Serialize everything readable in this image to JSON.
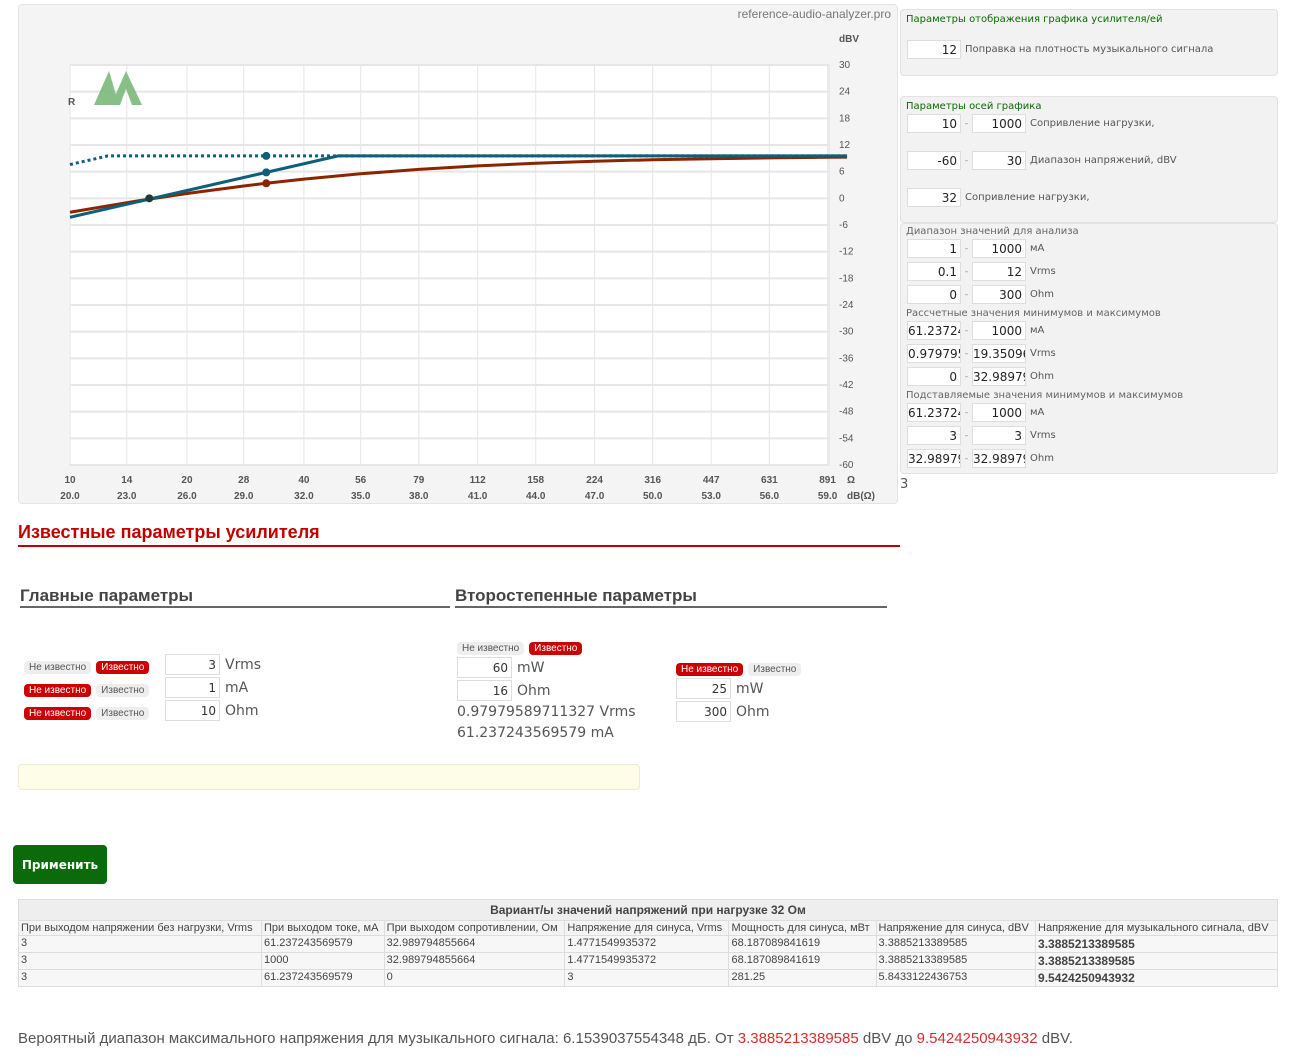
{
  "site": "reference-audio-analyzer.pro",
  "chart_data": {
    "type": "line",
    "x_scale": "log",
    "xlim": [
      10,
      1000
    ],
    "ylim": [
      -60,
      30
    ],
    "ylabel": "dBV",
    "xlabel_top": "Ω",
    "xlabel_bottom": "dB(Ω)",
    "x_ticks": [
      "10",
      "14",
      "20",
      "28",
      "40",
      "56",
      "79",
      "112",
      "158",
      "224",
      "316",
      "447",
      "631",
      "891"
    ],
    "x_ticks_db": [
      "20.0",
      "23.0",
      "26.0",
      "29.0",
      "32.0",
      "35.0",
      "38.0",
      "41.0",
      "44.0",
      "47.0",
      "50.0",
      "53.0",
      "56.0",
      "59.0"
    ],
    "y_ticks": [
      30,
      24,
      18,
      12,
      6,
      0,
      -6,
      -12,
      -18,
      -24,
      -30,
      -36,
      -42,
      -48,
      -54,
      -60
    ],
    "grid": true,
    "series": [
      {
        "color": "#8b2500",
        "style": "solid",
        "points": [
          [
            10,
            -3.13
          ],
          [
            14,
            -0.98
          ],
          [
            16,
            -0.18
          ],
          [
            20,
            1.08
          ],
          [
            28,
            2.78
          ],
          [
            32,
            3.39
          ],
          [
            40,
            4.32
          ],
          [
            56,
            5.52
          ],
          [
            79,
            6.51
          ],
          [
            112,
            7.3
          ],
          [
            158,
            7.9
          ],
          [
            224,
            8.35
          ],
          [
            316,
            8.68
          ],
          [
            447,
            8.92
          ],
          [
            631,
            9.1
          ],
          [
            891,
            9.23
          ],
          [
            1000,
            9.26
          ]
        ]
      },
      {
        "color": "#0e5f7a",
        "style": "solid",
        "points": [
          [
            10,
            -4.26
          ],
          [
            16,
            -0.18
          ],
          [
            32,
            5.84
          ],
          [
            49,
            9.54
          ],
          [
            1000,
            9.54
          ]
        ]
      },
      {
        "color": "#0e5f7a",
        "style": "dotted",
        "points": [
          [
            10,
            7.6
          ],
          [
            12.5,
            9.54
          ],
          [
            1000,
            9.54
          ]
        ]
      }
    ],
    "markers": [
      {
        "x": 32,
        "y": 9.54,
        "color": "#0e5f7a"
      },
      {
        "x": 32,
        "y": 5.84,
        "color": "#0e5f7a"
      },
      {
        "x": 32,
        "y": 3.39,
        "color": "#8b2500"
      },
      {
        "x": 16,
        "y": 0,
        "color": "#1e3a3a"
      }
    ]
  },
  "right": {
    "display": {
      "title": "Параметры отображения графика усилителя/ей",
      "value": "12",
      "label": "Поправка на плотность музыкального сигнала"
    },
    "axes": {
      "title": "Параметры осей графика",
      "load": {
        "min": "10",
        "max": "1000",
        "label": "Сопривление нагрузки,"
      },
      "volt": {
        "min": "-60",
        "max": "30",
        "label": "Диапазон напряжений, dBV"
      },
      "load2": {
        "value": "32",
        "label": "Сопривление нагрузки,"
      }
    },
    "range": {
      "title": "Диапазон значений для анализа",
      "rows": [
        [
          "1",
          "1000",
          "мА"
        ],
        [
          "0.1",
          "12",
          "Vrms"
        ],
        [
          "0",
          "300",
          "Ohm"
        ]
      ]
    },
    "calc": {
      "title": "Рассчетные значения минимумов и максимумов",
      "rows": [
        [
          "61.23724",
          "1000",
          "мА"
        ],
        [
          "0.979795",
          "19.35096",
          "Vrms"
        ],
        [
          "0",
          "32.98979",
          "Ohm"
        ]
      ]
    },
    "subst": {
      "title": "Подставляемые значения минимумов и максимумов",
      "rows": [
        [
          "61.23724",
          "1000",
          "мА"
        ],
        [
          "3",
          "3",
          "Vrms"
        ],
        [
          "32.98979",
          "32.98979",
          "Ohm"
        ]
      ]
    },
    "below": "3"
  },
  "known": {
    "title": "Известные параметры усилителя",
    "unknown": "Не известно",
    "known": "Известно",
    "main": {
      "title": "Главные параметры",
      "rows": [
        {
          "value": "3",
          "unit": "Vrms",
          "state": "known"
        },
        {
          "value": "1",
          "unit": "mA",
          "state": "unknown"
        },
        {
          "value": "10",
          "unit": "Ohm",
          "state": "unknown"
        }
      ]
    },
    "secondary": {
      "title": "Второстепенные параметры",
      "a": {
        "state": "known",
        "rows": [
          {
            "value": "60",
            "unit": "mW"
          },
          {
            "value": "16",
            "unit": "Ohm"
          }
        ],
        "results": [
          "0.97979589711327 Vrms",
          "61.237243569579 mA"
        ]
      },
      "b": {
        "state": "unknown",
        "rows": [
          {
            "value": "25",
            "unit": "mW"
          },
          {
            "value": "300",
            "unit": "Ohm"
          }
        ]
      }
    }
  },
  "apply": "Применить",
  "table": {
    "caption": "Вариант/ы значений напряжений при нагрузке 32 Ом",
    "headers": [
      "При выходом напряжении без нагрузки, Vrms",
      "При выходом токе, мА",
      "При выходом сопротивлении, Ом",
      "Напряжение для синуса, Vrms",
      "Мощность для синуса, мВт",
      "Напряжение для синуса, dBV",
      "Напряжение для музыкального сигнала, dBV"
    ],
    "rows": [
      [
        "3",
        "61.237243569579",
        "32.989794855664",
        "1.4771549935372",
        "68.187089841619",
        "3.3885213389585",
        "3.3885213389585"
      ],
      [
        "3",
        "1000",
        "32.989794855664",
        "1.4771549935372",
        "68.187089841619",
        "3.3885213389585",
        "3.3885213389585"
      ],
      [
        "3",
        "61.237243569579",
        "0",
        "3",
        "281.25",
        "5.843312243675​3",
        "9.5424250943932"
      ]
    ]
  },
  "summary": {
    "text": "Вероятный диапазон максимального напряжения для музыкального сигнала: 6.1539037554348 дБ. От ",
    "from": "3.3885213389585",
    "mid": " dBV до ",
    "to": "9.5424250943932",
    "end": " dBV."
  },
  "colors": {
    "accent_red": "#c00000",
    "green": "#0a6b00",
    "blue_series": "#0e5f7a",
    "brown_series": "#8b2500"
  }
}
